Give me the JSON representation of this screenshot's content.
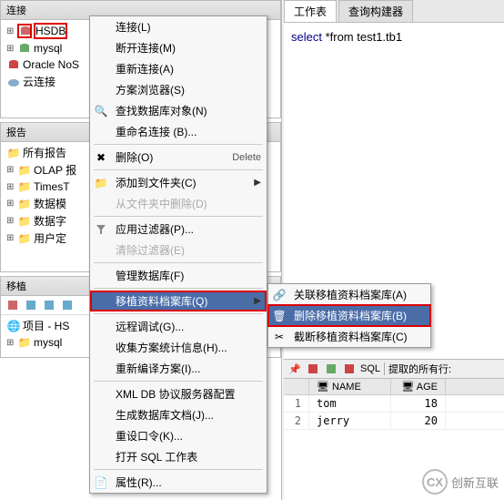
{
  "left": {
    "conn_header": "连接",
    "conn_items": [
      {
        "label": "HSDB",
        "hl": true
      },
      {
        "label": "mysql"
      },
      {
        "label": "Oracle NoS"
      },
      {
        "label": "云连接"
      }
    ],
    "report_header": "报告",
    "report_items": [
      {
        "label": "所有报告"
      },
      {
        "label": "OLAP 报"
      },
      {
        "label": "TimesT"
      },
      {
        "label": "数据模"
      },
      {
        "label": "数据字"
      },
      {
        "label": "用户定"
      }
    ],
    "port_header": "移植",
    "port_items": [
      {
        "label": "项目 - HS"
      },
      {
        "label": "mysql"
      }
    ]
  },
  "menu": {
    "items": [
      {
        "label": "连接(L)",
        "icon": ""
      },
      {
        "label": "断开连接(M)",
        "icon": ""
      },
      {
        "label": "重新连接(A)",
        "icon": ""
      },
      {
        "label": "方案浏览器(S)",
        "icon": ""
      },
      {
        "label": "查找数据库对象(N)",
        "icon": "search"
      },
      {
        "label": "重命名连接 (B)...",
        "icon": ""
      },
      {
        "sep": true
      },
      {
        "label": "删除(O)",
        "icon": "delete",
        "accel": "Delete"
      },
      {
        "sep": true
      },
      {
        "label": "添加到文件夹(C)",
        "icon": "folder",
        "sub": true
      },
      {
        "label": "从文件夹中删除(D)",
        "disabled": true
      },
      {
        "sep": true
      },
      {
        "label": "应用过滤器(P)...",
        "icon": "filter"
      },
      {
        "label": "清除过滤器(E)",
        "disabled": true
      },
      {
        "sep": true
      },
      {
        "label": "管理数据库(F)",
        "icon": ""
      },
      {
        "sep": true
      },
      {
        "label": "移植资料档案库(Q)",
        "icon": "",
        "sub": true,
        "hl": true
      },
      {
        "sep": true
      },
      {
        "label": "远程调试(G)...",
        "icon": ""
      },
      {
        "label": "收集方案统计信息(H)...",
        "icon": ""
      },
      {
        "label": "重新编译方案(I)...",
        "icon": ""
      },
      {
        "sep": true
      },
      {
        "label": "XML DB 协议服务器配置",
        "icon": ""
      },
      {
        "label": "生成数据库文档(J)...",
        "icon": ""
      },
      {
        "label": "重设口令(K)...",
        "icon": ""
      },
      {
        "label": "打开 SQL 工作表",
        "icon": ""
      },
      {
        "sep": true
      },
      {
        "label": "属性(R)...",
        "icon": "props"
      }
    ]
  },
  "submenu": {
    "items": [
      {
        "label": "关联移植资料档案库(A)",
        "icon": "link"
      },
      {
        "label": "删除移植资料档案库(B)",
        "icon": "delete-db",
        "hl": true
      },
      {
        "label": "截断移植资料档案库(C)",
        "icon": "trunc"
      }
    ]
  },
  "right": {
    "tabs": [
      "工作表",
      "查询构建器"
    ],
    "sql_kw1": "select",
    "sql_rest": " *from test1.tb1",
    "toolbar_sql": "SQL",
    "toolbar_hint": "提取的所有行:",
    "grid_headers": [
      "",
      "NAME",
      "AGE"
    ],
    "grid_rows": [
      {
        "n": "1",
        "name": "tom",
        "age": "18"
      },
      {
        "n": "2",
        "name": "jerry",
        "age": "20"
      }
    ]
  },
  "watermark": "创新互联"
}
